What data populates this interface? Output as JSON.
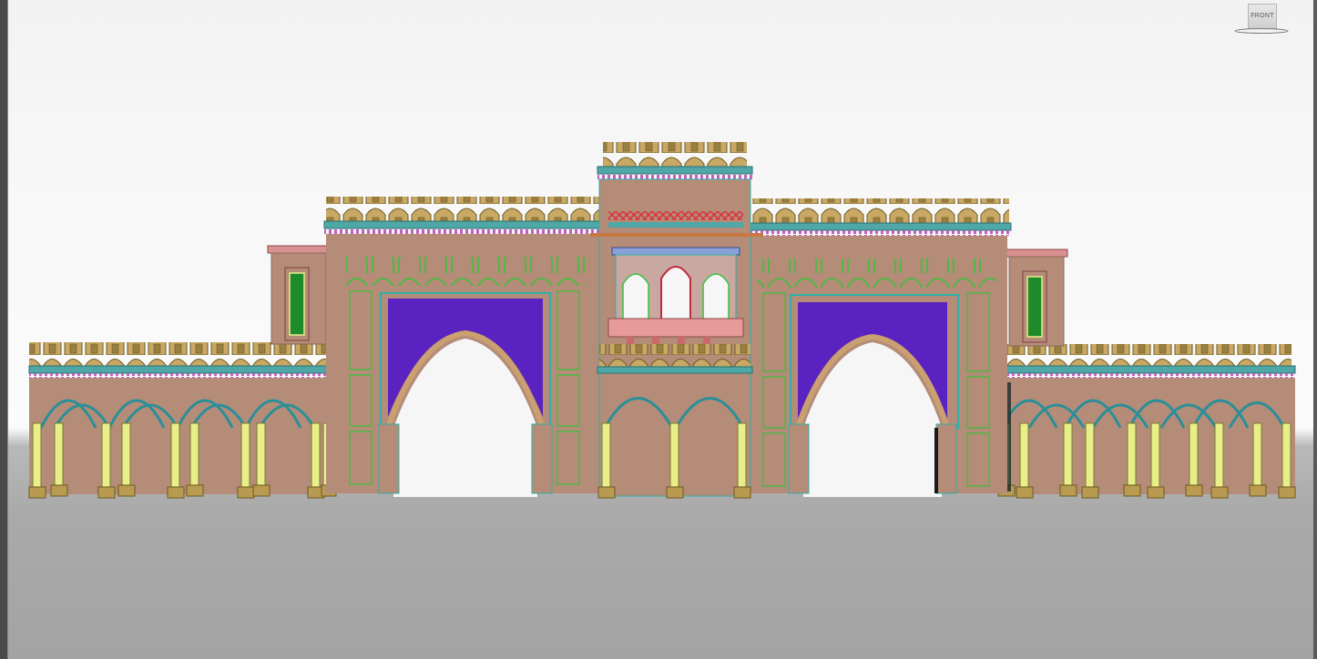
{
  "viewport": {
    "viewcube_label": "FRONT"
  },
  "colors": {
    "sky_top": "#f2f2f2",
    "ground": "#a8a8a8",
    "wall": "#b48c78",
    "wall_dark": "#a07c6a",
    "merlon": "#c8a864",
    "merlon_outline": "#6b5a22",
    "arch_fill_purple": "#5a22c0",
    "column_yellow": "#e8ee8a",
    "outline_green": "#3ac23a",
    "outline_cyan": "#2fb0a8",
    "trim_pink": "#e89ac8",
    "trim_red": "#e02a3a",
    "balcony_pink": "#e79a9a"
  },
  "icons": {
    "viewcube": "viewcube-icon"
  }
}
